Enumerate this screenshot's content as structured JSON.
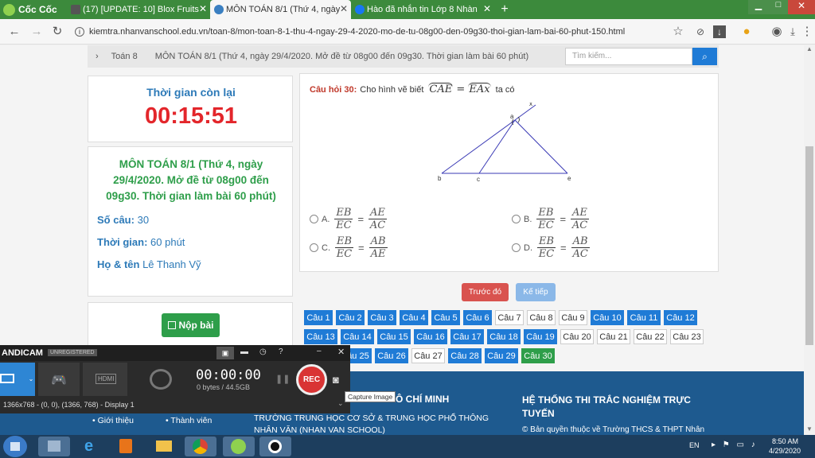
{
  "browser": {
    "brand": "Cốc Cốc",
    "tabs": [
      {
        "label": "(17) [UPDATE: 10] Blox Fruits",
        "active": false
      },
      {
        "label": "MÔN TOÁN 8/1 (Thứ 4, ngày",
        "active": true
      },
      {
        "label": "Hào đã nhắn tin Lớp 8 Nhàn",
        "active": false
      }
    ],
    "url": "kiemtra.nhanvanschool.edu.vn/toan-8/mon-toan-8-1-thu-4-ngay-29-4-2020-mo-de-tu-08g00-den-09g30-thoi-gian-lam-bai-60-phut-150.html"
  },
  "breadcrumb": {
    "items": [
      "Toán 8",
      "MÔN TOÁN 8/1 (Thứ 4, ngày 29/4/2020. Mở đề từ 08g00 đến 09g30. Thời gian làm bài 60 phút)"
    ]
  },
  "search": {
    "placeholder": "Tìm kiếm..."
  },
  "timer": {
    "label": "Thời gian còn lại",
    "value": "00:15:51"
  },
  "exam": {
    "title": "MÔN TOÁN 8/1 (Thứ 4, ngày 29/4/2020. Mở đề từ 08g00 đến 09g30. Thời gian làm bài 60 phút)",
    "count_label": "Số câu:",
    "count_value": "30",
    "time_label": "Thời gian:",
    "time_value": "60 phút",
    "name_label": "Họ & tên",
    "name_value": "Lê Thanh Vỹ",
    "submit_label": "Nộp bài"
  },
  "question": {
    "number_label": "Câu hỏi 30:",
    "text": "Cho hình vẽ biết",
    "text_after": "ta có",
    "figure_points": [
      "a",
      "x",
      "b",
      "c",
      "e"
    ],
    "options": [
      {
        "letter": "A.",
        "lnum": "EB",
        "lden": "EC",
        "rnum": "AE",
        "rden": "AC"
      },
      {
        "letter": "B.",
        "lnum": "EB",
        "lden": "EC",
        "rnum": "AE",
        "rden": "AC"
      },
      {
        "letter": "C.",
        "lnum": "EB",
        "lden": "EC",
        "rnum": "AB",
        "rden": "AE"
      },
      {
        "letter": "D.",
        "lnum": "EB",
        "lden": "EC",
        "rnum": "AB",
        "rden": "AC"
      }
    ]
  },
  "nav": {
    "prev_label": "Trước đó",
    "next_label": "Kế tiếp"
  },
  "questions": [
    {
      "label": "Câu 1",
      "state": "answered"
    },
    {
      "label": "Câu 2",
      "state": "answered"
    },
    {
      "label": "Câu 3",
      "state": "answered"
    },
    {
      "label": "Câu 4",
      "state": "answered"
    },
    {
      "label": "Câu 5",
      "state": "answered"
    },
    {
      "label": "Câu 6",
      "state": "answered"
    },
    {
      "label": "Câu 7",
      "state": "plain"
    },
    {
      "label": "Câu 8",
      "state": "plain"
    },
    {
      "label": "Câu 9",
      "state": "plain"
    },
    {
      "label": "Câu 10",
      "state": "answered"
    },
    {
      "label": "Câu 11",
      "state": "answered"
    },
    {
      "label": "Câu 12",
      "state": "answered"
    },
    {
      "label": "Câu 13",
      "state": "answered"
    },
    {
      "label": "Câu 14",
      "state": "answered"
    },
    {
      "label": "Câu 15",
      "state": "answered"
    },
    {
      "label": "Câu 16",
      "state": "answered"
    },
    {
      "label": "Câu 17",
      "state": "answered"
    },
    {
      "label": "Câu 18",
      "state": "answered"
    },
    {
      "label": "Câu 19",
      "state": "answered"
    },
    {
      "label": "Câu 20",
      "state": "plain"
    },
    {
      "label": "Câu 21",
      "state": "plain"
    },
    {
      "label": "Câu 22",
      "state": "plain"
    },
    {
      "label": "Câu 23",
      "state": "plain"
    },
    {
      "label": "Câu 25",
      "state": "answered"
    },
    {
      "label": "Câu 26",
      "state": "answered"
    },
    {
      "label": "Câu 27",
      "state": "plain"
    },
    {
      "label": "Câu 28",
      "state": "answered"
    },
    {
      "label": "Câu 29",
      "state": "answered"
    },
    {
      "label": "Câu 30",
      "state": "current"
    }
  ],
  "footer": {
    "col1_items": [
      "Giới thiệu",
      "Thành viên"
    ],
    "col2_title": "Ô CHÍ MINH",
    "col2_text": "TRƯỜNG TRUNG HỌC CƠ SỞ & TRUNG HỌC PHỔ THÔNG NHÂN VĂN (NHAN VAN SCHOOL)",
    "col3_title": "HỆ THỐNG THI TRẮC NGHIỆM TRỰC TUYẾN",
    "col3_text": "© Bản quyền thuộc về Trường THCS & THPT Nhân"
  },
  "bandicam": {
    "brand": "ANDICAM",
    "badge": "UNREGISTERED",
    "time": "00:00:00",
    "size": "0 bytes / 44.5GB",
    "rec_label": "REC",
    "status": "1366x768 - (0, 0), (1366, 768) - Display 1",
    "tooltip": "Capture Image",
    "hdmi_label": "HDMI"
  },
  "taskbar": {
    "lang": "EN",
    "time": "8:50 AM",
    "date": "4/29/2020"
  },
  "colors": {
    "accent_green": "#2e9e4a",
    "timer_red": "#e3262b",
    "btn_blue": "#1f7bd6",
    "footer_blue": "#1e5a8f"
  }
}
